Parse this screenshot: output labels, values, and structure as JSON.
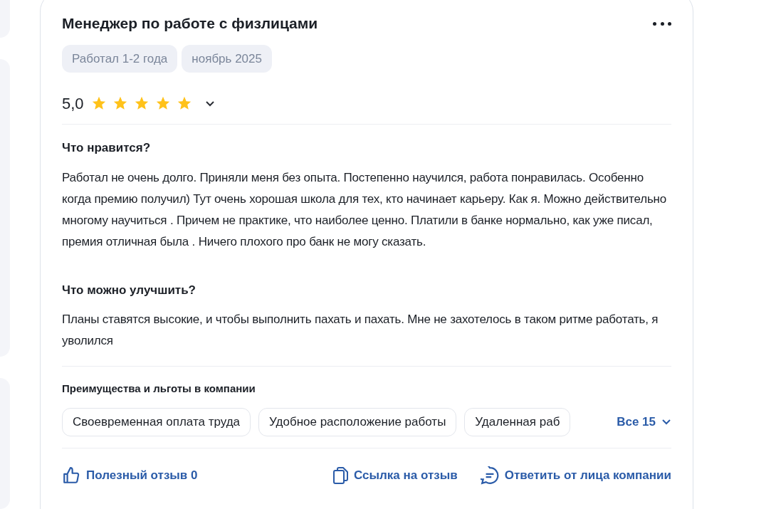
{
  "review": {
    "title": "Менеджер по работе с физлицами",
    "tags": [
      "Работал 1-2 года",
      "ноябрь 2025"
    ],
    "rating": {
      "value": "5,0",
      "stars": 5
    },
    "sections": [
      {
        "heading": "Что нравится?",
        "text": "Работал не очень долго. Приняли меня без опыта. Постепенно научился, работа понравилась. Особенно когда премию получил) Тут очень хорошая школа для тех, кто начинает карьеру. Как я. Можно действительно многому научиться . Причем не практике, что наиболее ценно. Платили в банке нормально, как уже писал, премия отличная была . Ничего плохого про банк не могу сказать."
      },
      {
        "heading": "Что можно улучшить?",
        "text": "Планы ставятся высокие, и чтобы выполнить пахать и пахать. Мне не захотелось в таком ритме работать, я уволился"
      }
    ],
    "benefits": {
      "heading": "Преимущества и льготы в компании",
      "items": [
        "Своевременная оплата труда",
        "Удобное расположение работы",
        "Удаленная раб"
      ],
      "more": "Все 15"
    },
    "actions": {
      "helpful": "Полезный отзыв 0",
      "link": "Ссылка на отзыв",
      "reply": "Ответить от лица компании"
    }
  }
}
